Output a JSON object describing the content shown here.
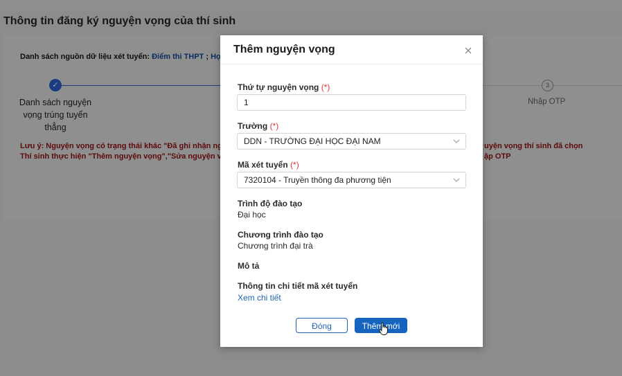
{
  "page": {
    "title": "Thông tin đăng ký nguyện vọng của thí sinh",
    "source_list_label": "Danh sách nguồn dữ liệu xét tuyển:",
    "source_list_value1": "Điểm thi THPT",
    "source_list_sep": ";",
    "source_list_value2": "Học",
    "steps": [
      {
        "number": "",
        "label_lines": [
          "Danh sách nguyện",
          "vọng trúng tuyển",
          "thẳng"
        ]
      },
      {
        "number": "3",
        "label": "Nhập OTP"
      }
    ],
    "note_left_line1": "Lưu ý: Nguyện vọng có trạng thái khác \"Đã ghi nhận ngu",
    "note_left_line2": "Thí sinh thực hiện \"Thêm nguyện vọng\",\"Sửa nguyện v",
    "note_right_line1": "uyện vọng thí sinh đã chọn",
    "note_right_line2": "ập OTP"
  },
  "modal": {
    "title": "Thêm nguyện vọng",
    "close_icon": "close-icon",
    "fields": {
      "order": {
        "label": "Thứ tự nguyện vọng",
        "required_mark": "(*)",
        "value": "1"
      },
      "school": {
        "label": "Trường",
        "required_mark": "(*)",
        "value": "DDN - TRƯỜNG ĐẠI HỌC ĐẠI NAM"
      },
      "admission_code": {
        "label": "Mã xét tuyển",
        "required_mark": "(*)",
        "value": "7320104 - Truyền thông đa phương tiện"
      },
      "education_level": {
        "label": "Trình độ đào tạo",
        "value": "Đại học"
      },
      "program": {
        "label": "Chương trình đào tạo",
        "value": "Chương trình đại trà"
      },
      "description": {
        "label": "Mô tả",
        "value": ""
      },
      "details": {
        "label": "Thông tin chi tiết mã xét tuyển",
        "link": "Xem chi tiết"
      }
    },
    "buttons": {
      "close": "Đóng",
      "add": "Thêm mới"
    }
  },
  "colors": {
    "primary": "#1565c0",
    "link": "#1f64b5",
    "required": "#d9363e",
    "overlay": "#8c8c8c"
  }
}
